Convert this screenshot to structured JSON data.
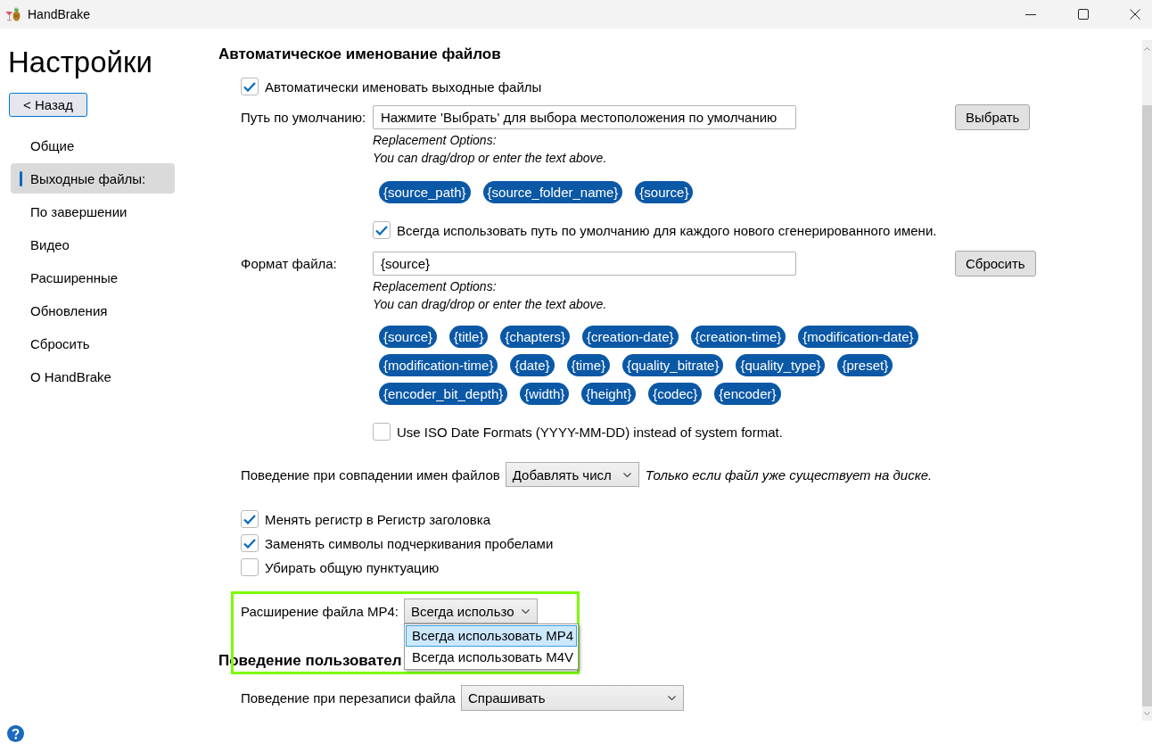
{
  "window": {
    "title": "HandBrake"
  },
  "sidebar": {
    "title": "Настройки",
    "back_button": "< Назад",
    "items": [
      {
        "label": "Общие",
        "selected": false
      },
      {
        "label": "Выходные файлы:",
        "selected": true
      },
      {
        "label": "По завершении",
        "selected": false
      },
      {
        "label": "Видео",
        "selected": false
      },
      {
        "label": "Расширенные",
        "selected": false
      },
      {
        "label": "Обновления",
        "selected": false
      },
      {
        "label": "Сбросить",
        "selected": false
      },
      {
        "label": "О HandBrake",
        "selected": false
      }
    ]
  },
  "auto_naming": {
    "heading": "Автоматическое именование файлов",
    "auto_name": {
      "label": "Автоматически именовать выходные файлы",
      "checked": true
    },
    "default_path": {
      "label": "Путь по умолчанию:",
      "value": "Нажмите 'Выбрать' для выбора местоположения по умолчанию",
      "button": "Выбрать",
      "hints": [
        "Replacement Options:",
        "You can drag/drop or enter the text above."
      ],
      "token_rows": [
        [
          "{source_path}",
          "{source_folder_name}",
          "{source}"
        ]
      ]
    },
    "always_use_default_path": {
      "label": "Всегда использовать путь по умолчанию для каждого нового сгенерированного имени.",
      "checked": true
    },
    "file_format": {
      "label": "Формат файла:",
      "value": "{source}",
      "button": "Сбросить",
      "hints": [
        "Replacement Options:",
        "You can drag/drop or enter the text above."
      ],
      "token_rows": [
        [
          "{source}",
          "{title}",
          "{chapters}",
          "{creation-date}",
          "{creation-time}",
          "{modification-date}"
        ],
        [
          "{modification-time}",
          "{date}",
          "{time}",
          "{quality_bitrate}",
          "{quality_type}",
          "{preset}"
        ],
        [
          "{encoder_bit_depth}",
          "{width}",
          "{height}",
          "{codec}",
          "{encoder}"
        ]
      ]
    },
    "iso_dates": {
      "label": "Use ISO Date Formats (YYYY-MM-DD) instead of system format.",
      "checked": false
    },
    "name_collision": {
      "label": "Поведение при совпадении имен файлов",
      "value": "Добавлять числ",
      "note": "Только если файл уже существует на диске."
    },
    "options": [
      {
        "label": "Менять регистр в Регистр заголовка",
        "checked": true
      },
      {
        "label": "Заменять символы подчеркивания пробелами",
        "checked": true
      },
      {
        "label": "Убирать общую пунктуацию",
        "checked": false
      }
    ],
    "mp4_extension": {
      "label": "Расширение файла MP4:",
      "value": "Всегда использо",
      "expanded": true,
      "highlighted": true,
      "options": [
        {
          "label": "Всегда использовать MP4",
          "selected": true
        },
        {
          "label": "Всегда использовать M4V",
          "selected": false
        }
      ]
    }
  },
  "overwrite": {
    "heading": "Поведение пользовател",
    "label": "Поведение при перезаписи файла",
    "value": "Спрашивать"
  }
}
